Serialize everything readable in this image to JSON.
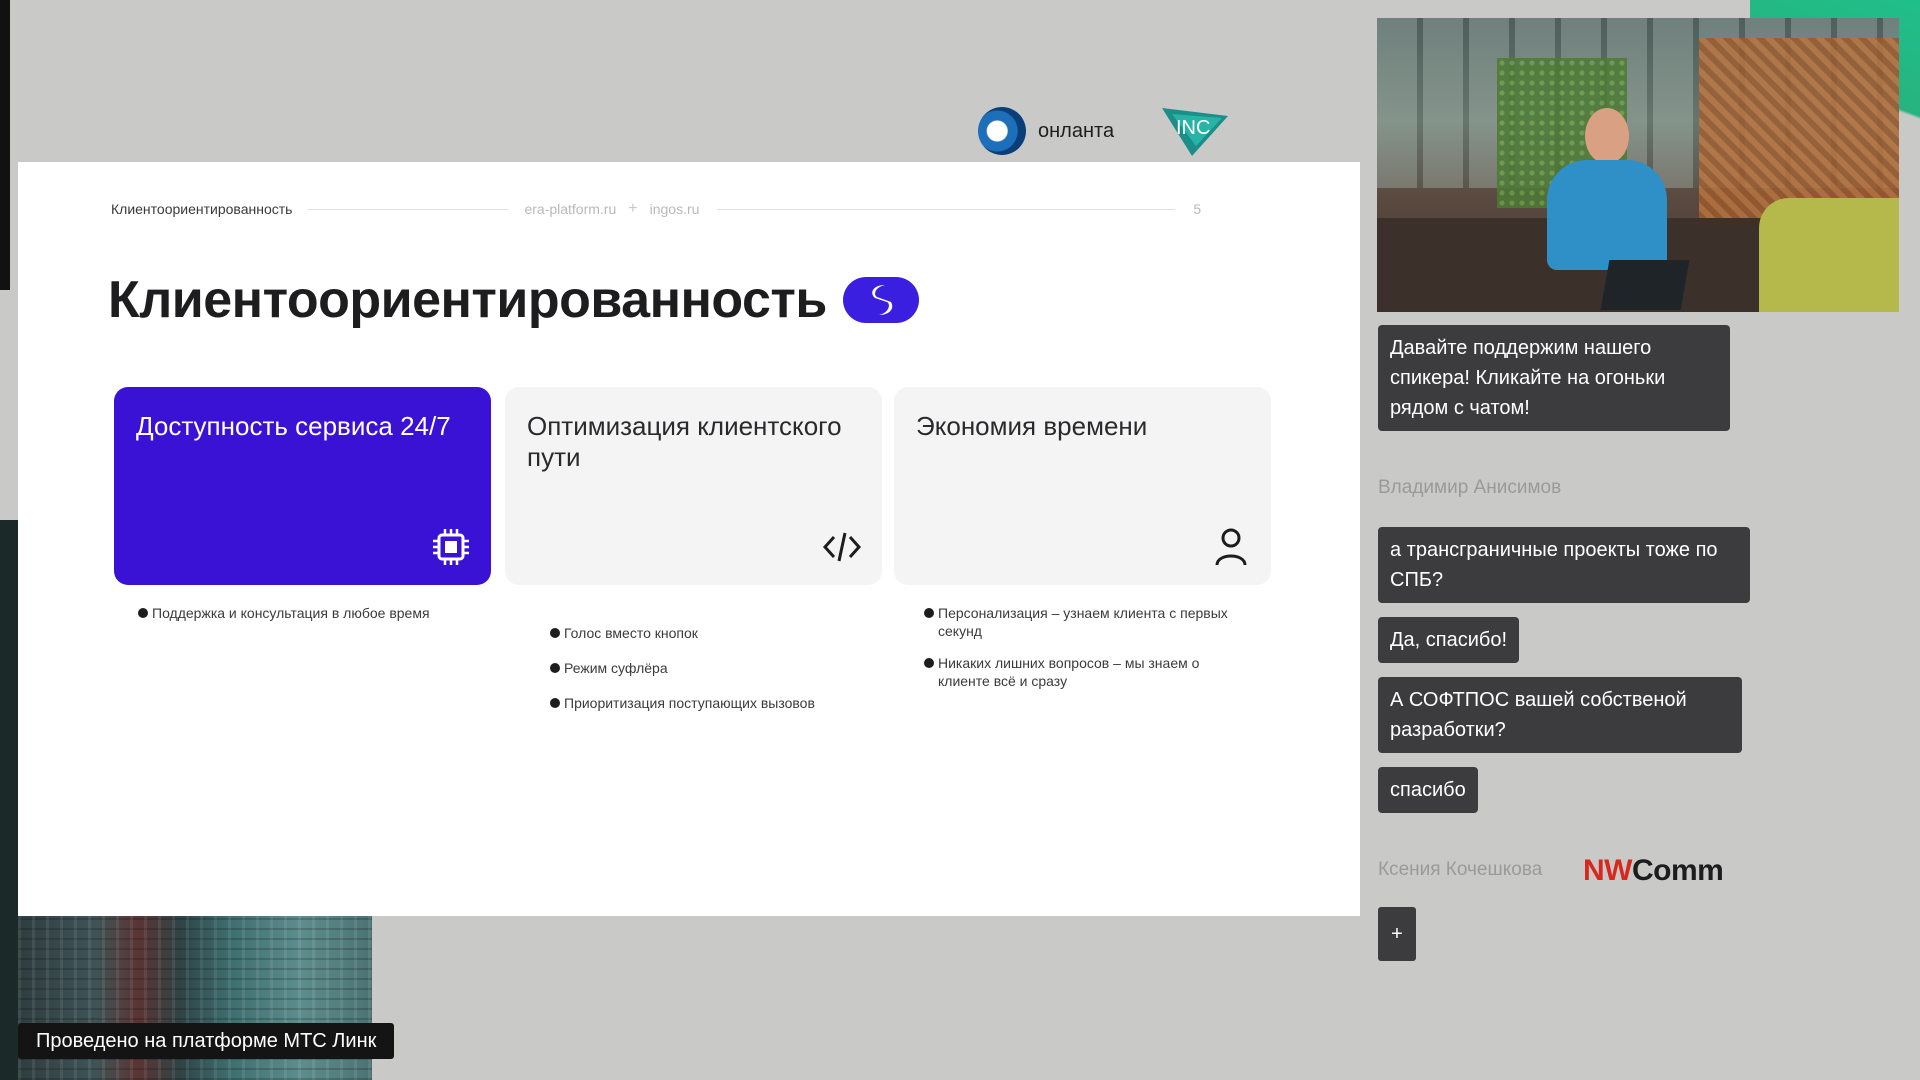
{
  "logos": {
    "onlanta_text": "онланта",
    "inc_text": "INC"
  },
  "slide": {
    "breadcrumb": "Клиентоориентированность",
    "site1": "era-platform.ru",
    "plus": "+",
    "site2": "ingos.ru",
    "page_number": "5",
    "title": "Клиентоориентированность",
    "cards": [
      {
        "title": "Доступность сервиса 24/7",
        "icon": "chip-icon"
      },
      {
        "title": "Оптимизация клиентского пути",
        "icon": "code-icon"
      },
      {
        "title": "Экономия времени",
        "icon": "person-icon"
      }
    ],
    "bullets": [
      [
        "Поддержка и консультация в любое время"
      ],
      [
        "Голос вместо кнопок",
        "Режим суфлёра",
        "Приоритизация поступающих вызовов"
      ],
      [
        "Персонализация – узнаем клиента с первых секунд",
        "Никаких лишних вопросов – мы знаем о клиенте всё и сразу"
      ]
    ],
    "accent_color": "#3a12d6"
  },
  "chat": {
    "messages": [
      "Давайте поддержим нашего спикера! Кликайте на огоньки рядом с чатом!",
      "а трансграничные проекты тоже по СПБ?",
      "Да, спасибо!",
      "А СОФТПОС вашей собственой разработки?",
      "спасибо"
    ],
    "sender1": "Владимир Анисимов",
    "sender2": "Ксения Кочешкова",
    "add_label": "+"
  },
  "brand": {
    "nw": "NW",
    "comm": "Comm"
  },
  "footer": {
    "badge": "Проведено на платформе МТС Линк"
  }
}
